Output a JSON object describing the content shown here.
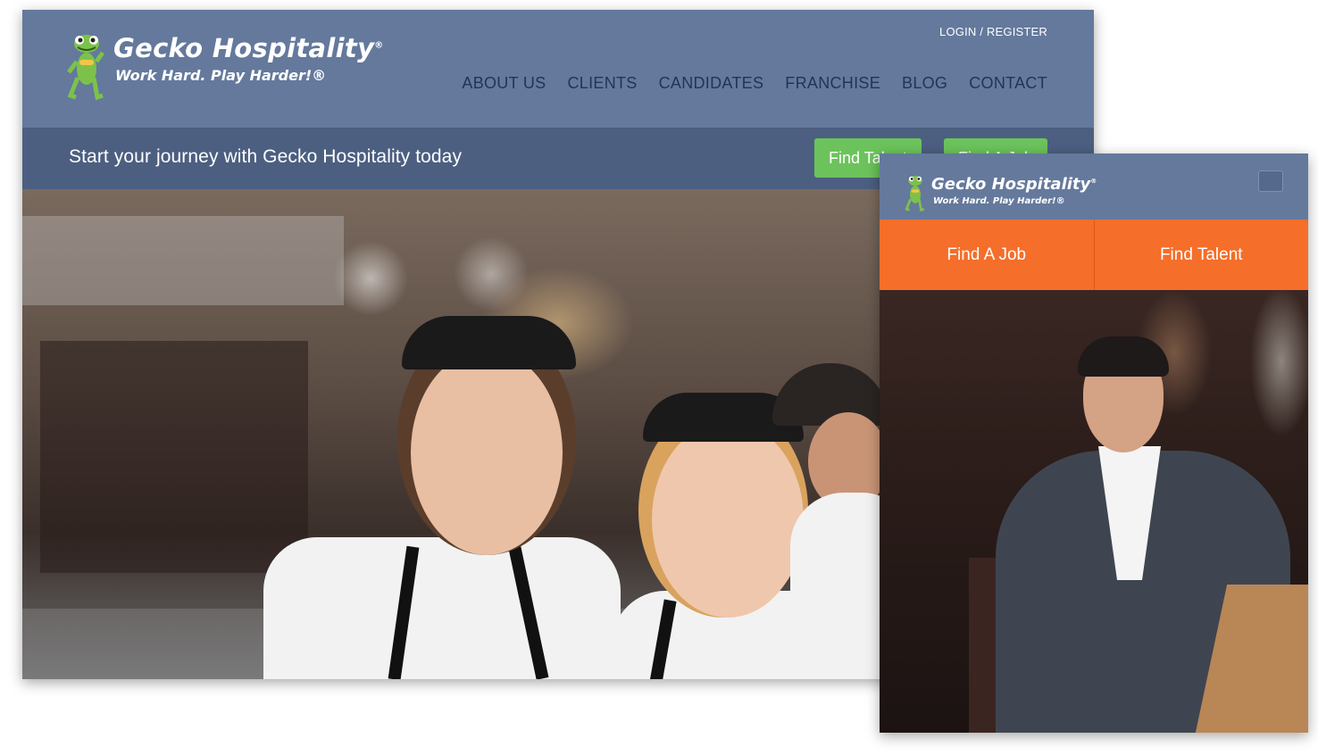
{
  "desktop": {
    "logo": {
      "name": "Gecko Hospitality",
      "registered": "®",
      "tagline": "Work Hard. Play Harder!®",
      "icon": "gecko-mascot-icon"
    },
    "login_link": "LOGIN / REGISTER",
    "nav": [
      {
        "label": "ABOUT US"
      },
      {
        "label": "CLIENTS"
      },
      {
        "label": "CANDIDATES"
      },
      {
        "label": "FRANCHISE"
      },
      {
        "label": "BLOG"
      },
      {
        "label": "CONTACT"
      }
    ],
    "banner_text": "Start your journey with Gecko Hospitality today",
    "buttons": {
      "find_talent": "Find Talent",
      "find_a_job": "Find A Job"
    },
    "hero_image": "two-smiling-chefs-photo"
  },
  "mobile": {
    "logo": {
      "name": "Gecko Hospitality",
      "registered": "®",
      "tagline": "Work Hard. Play Harder!®",
      "icon": "gecko-mascot-icon"
    },
    "menu_icon": "hamburger-menu-icon",
    "buttons": {
      "find_a_job": "Find A Job",
      "find_talent": "Find Talent"
    },
    "hero_image": "man-in-suit-restaurant-photo"
  },
  "colors": {
    "header_blue": "#64799c",
    "banner_blue": "#4c5f80",
    "nav_text": "#233554",
    "green_button": "#6cc35c",
    "orange_button": "#f56e2a"
  }
}
